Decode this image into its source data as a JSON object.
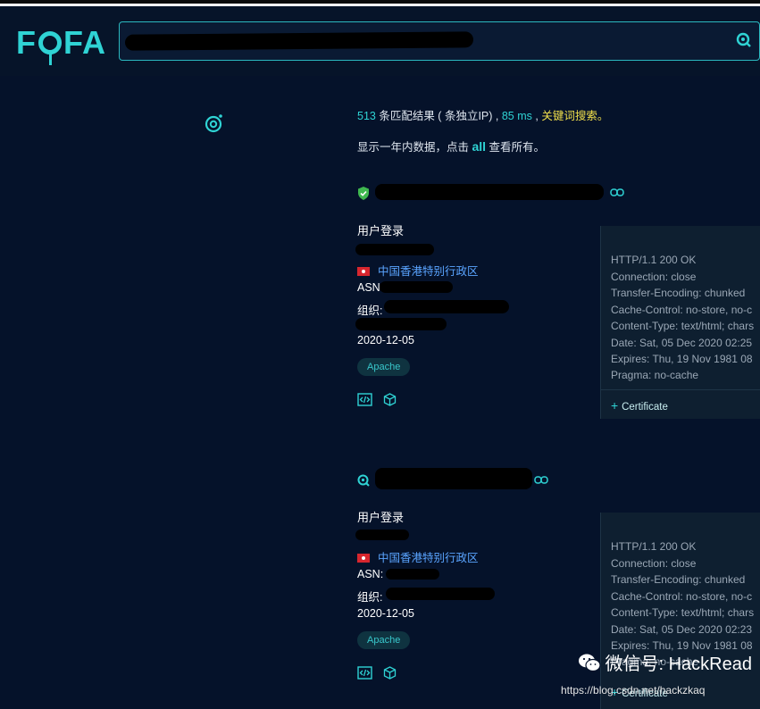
{
  "logo": "FOFA",
  "summary": {
    "count": "513",
    "text1": " 条匹配结果 ( 条独立IP) , ",
    "time": "85 ms",
    "text2": " , ",
    "keyword_link": "关键词搜索。"
  },
  "notice": {
    "before": "显示一年内数据，点击 ",
    "all": "all",
    "after": " 查看所有。"
  },
  "results": [
    {
      "title": "用户登录",
      "location": "中国香港特别行政区",
      "asn_label": "ASN",
      "org_label": "组织:",
      "date": "2020-12-05",
      "tag": "Apache",
      "headers": [
        "HTTP/1.1 200 OK",
        "Connection: close",
        "Transfer-Encoding: chunked",
        "Cache-Control: no-store, no-c",
        "Content-Type: text/html; chars",
        "Date: Sat, 05 Dec 2020 02:25",
        "Expires: Thu, 19 Nov 1981 08",
        "Pragma: no-cache"
      ],
      "cert": "Certificate"
    },
    {
      "title": "用户登录",
      "location": "中国香港特别行政区",
      "asn_label": "ASN:",
      "org_label": "组织:",
      "date": "2020-12-05",
      "tag": "Apache",
      "headers": [
        "HTTP/1.1 200 OK",
        "Connection: close",
        "Transfer-Encoding: chunked",
        "Cache-Control: no-store, no-c",
        "Content-Type: text/html; chars",
        "Date: Sat, 05 Dec 2020 02:23",
        "Expires: Thu, 19 Nov 1981 08",
        "Pragma: no-cache"
      ],
      "cert": "Certificate"
    }
  ],
  "watermark": {
    "wechat": "微信号: HackRead",
    "url": "https://blog.csdn.net/hackzkaq"
  }
}
